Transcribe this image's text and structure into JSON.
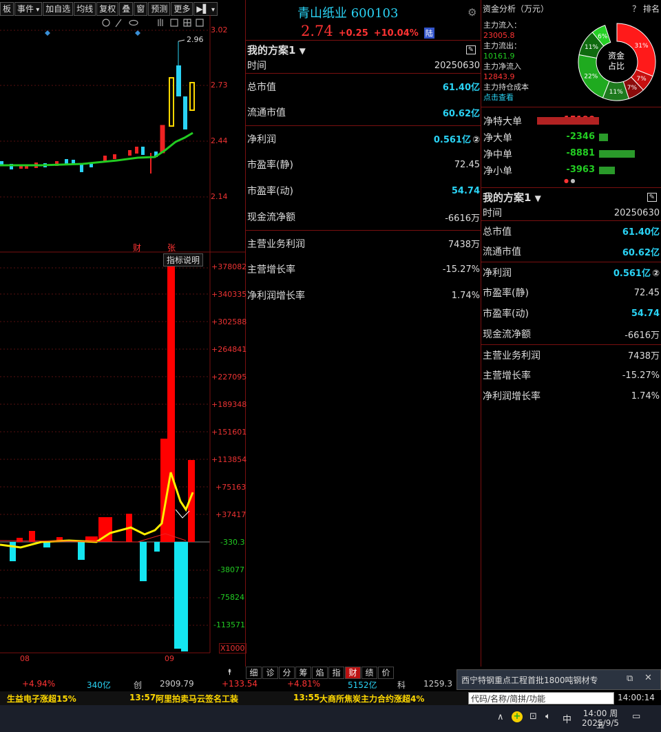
{
  "toolbar": {
    "items": [
      "板",
      "事件",
      "加自选",
      "均线",
      "复权",
      "叠",
      "窗",
      "预测",
      "更多",
      "▶▌"
    ]
  },
  "chart": {
    "price_axis": [
      "3.02",
      "2.73",
      "2.44",
      "2.14"
    ],
    "high_label": "2.96",
    "markers": [
      "财",
      "张"
    ],
    "indicator_btn": "指标说明",
    "vol_axis": [
      "+378082",
      "+340335",
      "+302588",
      "+264841",
      "+227095",
      "+189348",
      "+151601",
      "+113854",
      "+75163",
      "+37417",
      "-330.3",
      "-38077",
      "-75824",
      "-113571"
    ],
    "multiplier": "X1000",
    "months": [
      "08",
      "09"
    ]
  },
  "header": {
    "name": "青山纸业",
    "code": "600103",
    "price": "2.74",
    "change": "+0.25",
    "pct": "+10.04%",
    "badge": "陆"
  },
  "plan": {
    "title": "我的方案1",
    "rows": [
      {
        "label": "时间",
        "value": "20250630",
        "hl": false
      },
      {
        "label": "总市值",
        "value": "61.40亿",
        "hl": true
      },
      {
        "label": "流通市值",
        "value": "60.62亿",
        "hl": true
      },
      {
        "label": "净利润",
        "value": "0.561亿",
        "hl": true,
        "badge": "②"
      },
      {
        "label": "市盈率(静)",
        "value": "72.45",
        "hl": false
      },
      {
        "label": "市盈率(动)",
        "value": "54.74",
        "hl": true
      },
      {
        "label": "现金流净额",
        "value": "-6616万",
        "hl": false
      },
      {
        "label": "主营业务利润",
        "value": "7438万",
        "hl": false
      },
      {
        "label": "主营增长率",
        "value": "-15.27%",
        "hl": false
      },
      {
        "label": "净利润增长率",
        "value": "1.74%",
        "hl": false
      }
    ]
  },
  "funds": {
    "title": "资金分析（万元）",
    "help": "？ 排名",
    "inflow_label": "主力流入：",
    "inflow": "23005.8",
    "outflow_label": "主力流出：",
    "outflow": "10161.9",
    "net_label": "主力净流入",
    "net": "12843.9",
    "cost_label": "主力持仓成本",
    "link": "点击查看",
    "donut_center": [
      "资金",
      "占比"
    ],
    "slices": [
      "31%",
      "7%",
      "7%",
      "11%",
      "22%",
      "11%",
      "6%"
    ],
    "flows": [
      {
        "label": "净特大单",
        "value": "15190",
        "sign": "pos",
        "frac": 1.0
      },
      {
        "label": "净大单",
        "value": "-2346",
        "sign": "neg",
        "frac": 0.12
      },
      {
        "label": "净中单",
        "value": "-8881",
        "sign": "neg",
        "frac": 0.47
      },
      {
        "label": "净小单",
        "value": "-3963",
        "sign": "neg",
        "frac": 0.21
      }
    ]
  },
  "tabs": [
    "细",
    "诊",
    "分",
    "筹",
    "焰",
    "指",
    "财",
    "绩",
    "价"
  ],
  "status": {
    "s1": "+4.94%",
    "s2": "340亿",
    "s3": "创",
    "s4": "2909.79",
    "s5": "+133.54",
    "s6": "+4.81%",
    "s7": "5152亿",
    "s8": "科",
    "s9": "1259.3"
  },
  "ticker": [
    {
      "time": "",
      "text": "生益电子涨超15%"
    },
    {
      "time": "13:57",
      "text": "阿里拍卖马云签名工装"
    },
    {
      "time": "13:55",
      "text": "大商所焦炭主力合约涨超4%"
    }
  ],
  "news": {
    "text": "西宁特钢重点工程首批1800吨钢材专",
    "search": "代码/名称/简拼/功能",
    "clock": "14:00:14"
  },
  "taskbar": {
    "time": "14:00 周五",
    "date": "2025/9/5",
    "ime": "中"
  }
}
